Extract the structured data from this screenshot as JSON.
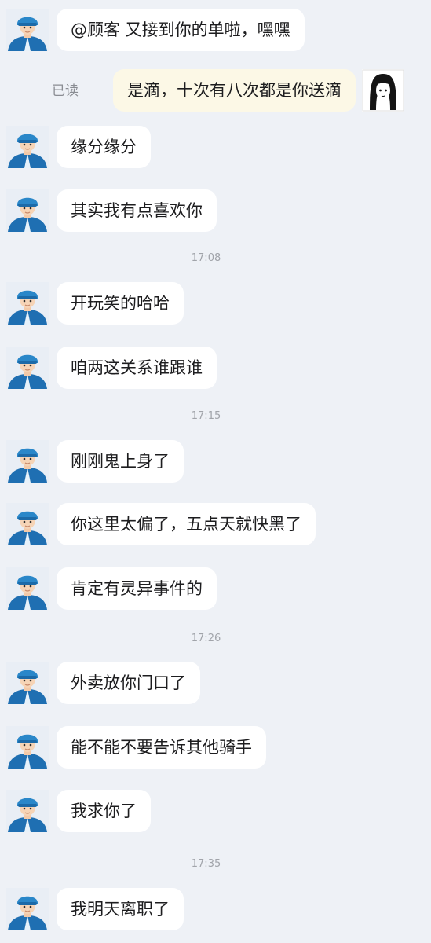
{
  "colors": {
    "background": "#EEF1F6",
    "incoming_bubble": "#FFFFFF",
    "outgoing_bubble": "#FCF8E6",
    "rider_helmet": "#2A87C9",
    "rider_jacket": "#1F6FB2"
  },
  "messages": [
    {
      "text": "@顾客 又接到你的单啦，嘿嘿",
      "side": "left",
      "avatar": "rider-avatar"
    },
    {
      "text": "是滴，十次有八次都是你送滴",
      "side": "right",
      "avatar": "customer-avatar",
      "status": "已读"
    },
    {
      "text": "缘分缘分",
      "side": "left",
      "avatar": "rider-avatar"
    },
    {
      "text": "其实我有点喜欢你",
      "side": "left",
      "avatar": "rider-avatar"
    },
    {
      "time": "17:08"
    },
    {
      "text": "开玩笑的哈哈",
      "side": "left",
      "avatar": "rider-avatar"
    },
    {
      "text": "咱两这关系谁跟谁",
      "side": "left",
      "avatar": "rider-avatar"
    },
    {
      "time": "17:15"
    },
    {
      "text": "刚刚鬼上身了",
      "side": "left",
      "avatar": "rider-avatar"
    },
    {
      "text": "你这里太偏了，五点天就快黑了",
      "side": "left",
      "avatar": "rider-avatar"
    },
    {
      "text": "肯定有灵异事件的",
      "side": "left",
      "avatar": "rider-avatar"
    },
    {
      "time": "17:26"
    },
    {
      "text": "外卖放你门口了",
      "side": "left",
      "avatar": "rider-avatar"
    },
    {
      "text": "能不能不要告诉其他骑手",
      "side": "left",
      "avatar": "rider-avatar"
    },
    {
      "text": "我求你了",
      "side": "left",
      "avatar": "rider-avatar"
    },
    {
      "time": "17:35"
    },
    {
      "text": "我明天离职了",
      "side": "left",
      "avatar": "rider-avatar"
    }
  ]
}
